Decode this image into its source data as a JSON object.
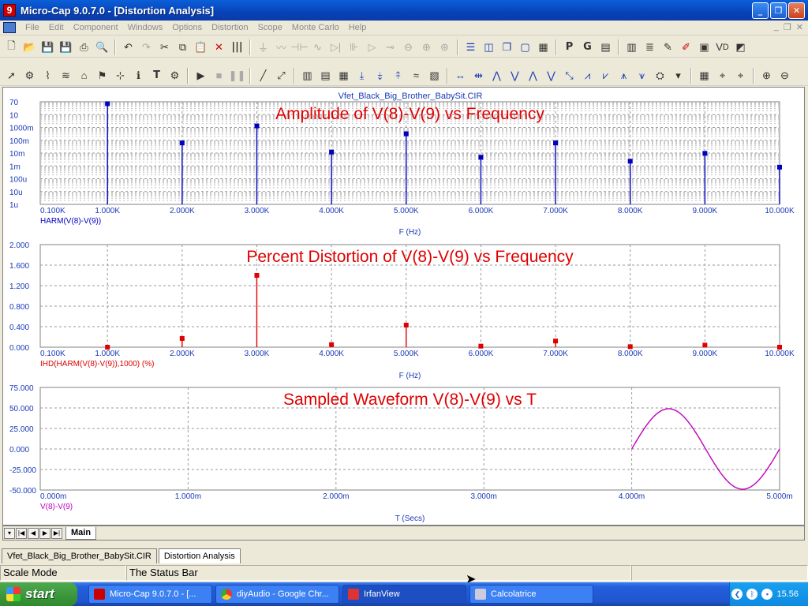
{
  "window": {
    "title": "Micro-Cap 9.0.7.0 - [Distortion Analysis]",
    "app_icon": "9"
  },
  "menu": [
    "File",
    "Edit",
    "Component",
    "Windows",
    "Options",
    "Distortion",
    "Scope",
    "Monte Carlo",
    "Help"
  ],
  "toolbar2": {
    "text_tool": "T",
    "p_btn": "P",
    "g_btn": "G"
  },
  "plot": {
    "filename": "Vfet_Black_Big_Brother_BabySit.CIR",
    "panel1": {
      "title": "Amplitude of V(8)-V(9) vs Frequency",
      "trace": "HARM(V(8)-V(9))",
      "xlabel": "F (Hz)"
    },
    "panel2": {
      "title": "Percent Distortion of V(8)-V(9) vs Frequency",
      "trace": "IHD(HARM(V(8)-V(9)),1000) (%)",
      "xlabel": "F (Hz)"
    },
    "panel3": {
      "title": "Sampled Waveform  V(8)-V(9) vs T",
      "trace": "V(8)-V(9)",
      "xlabel": "T (Secs)"
    }
  },
  "chart_data": [
    {
      "type": "bar",
      "title": "Amplitude of V(8)-V(9) vs Frequency",
      "xlabel": "F (Hz)",
      "ylabel": "HARM(V(8)-V(9))",
      "x_ticks": [
        "0.100K",
        "1.000K",
        "2.000K",
        "3.000K",
        "4.000K",
        "5.000K",
        "6.000K",
        "7.000K",
        "8.000K",
        "9.000K",
        "10.000K"
      ],
      "y_ticks": [
        "70",
        "10",
        "1000m",
        "100m",
        "10m",
        "1m",
        "100u",
        "10u",
        "1u"
      ],
      "y_scale": "log",
      "xlim": [
        100,
        10000
      ],
      "ylim": [
        1e-06,
        70
      ],
      "color": "#0000c0",
      "x": [
        1000,
        2000,
        3000,
        4000,
        5000,
        6000,
        7000,
        8000,
        9000,
        10000
      ],
      "values": [
        50,
        0.05,
        1,
        0.01,
        0.25,
        0.004,
        0.05,
        0.002,
        0.008,
        0.0007
      ]
    },
    {
      "type": "bar",
      "title": "Percent Distortion of V(8)-V(9) vs Frequency",
      "xlabel": "F (Hz)",
      "ylabel": "IHD(HARM(V(8)-V(9)),1000) (%)",
      "x_ticks": [
        "0.100K",
        "1.000K",
        "2.000K",
        "3.000K",
        "4.000K",
        "5.000K",
        "6.000K",
        "7.000K",
        "8.000K",
        "9.000K",
        "10.000K"
      ],
      "y_ticks": [
        "2.000",
        "1.600",
        "1.200",
        "0.800",
        "0.400",
        "0.000"
      ],
      "xlim": [
        100,
        10000
      ],
      "ylim": [
        0,
        2
      ],
      "color": "#e00000",
      "x": [
        1000,
        2000,
        3000,
        4000,
        5000,
        6000,
        7000,
        8000,
        9000,
        10000
      ],
      "values": [
        0.0,
        0.17,
        1.4,
        0.05,
        0.43,
        0.02,
        0.12,
        0.01,
        0.04,
        0.0
      ]
    },
    {
      "type": "line",
      "title": "Sampled Waveform  V(8)-V(9) vs T",
      "xlabel": "T (Secs)",
      "ylabel": "V(8)-V(9)",
      "x_ticks": [
        "0.000m",
        "1.000m",
        "2.000m",
        "3.000m",
        "4.000m",
        "5.000m"
      ],
      "y_ticks": [
        "75.000",
        "50.000",
        "25.000",
        "0.000",
        "-25.000",
        "-50.000"
      ],
      "xlim": [
        0,
        0.005
      ],
      "ylim": [
        -50,
        75
      ],
      "color": "#c000c0",
      "x_start": 0.004,
      "x_end": 0.005,
      "amplitude": 49,
      "frequency": 1000
    }
  ],
  "tabs": {
    "sheet": "Main",
    "docs": [
      "Vfet_Black_Big_Brother_BabySit.CIR",
      "Distortion Analysis"
    ]
  },
  "status": {
    "mode": "Scale Mode",
    "text": "The Status Bar"
  },
  "taskbar": {
    "start": "start",
    "tasks": [
      "Micro-Cap 9.0.7.0 - [...",
      "diyAudio - Google Chr...",
      "IrfanView",
      "Calcolatrice"
    ],
    "clock": "15.56"
  }
}
